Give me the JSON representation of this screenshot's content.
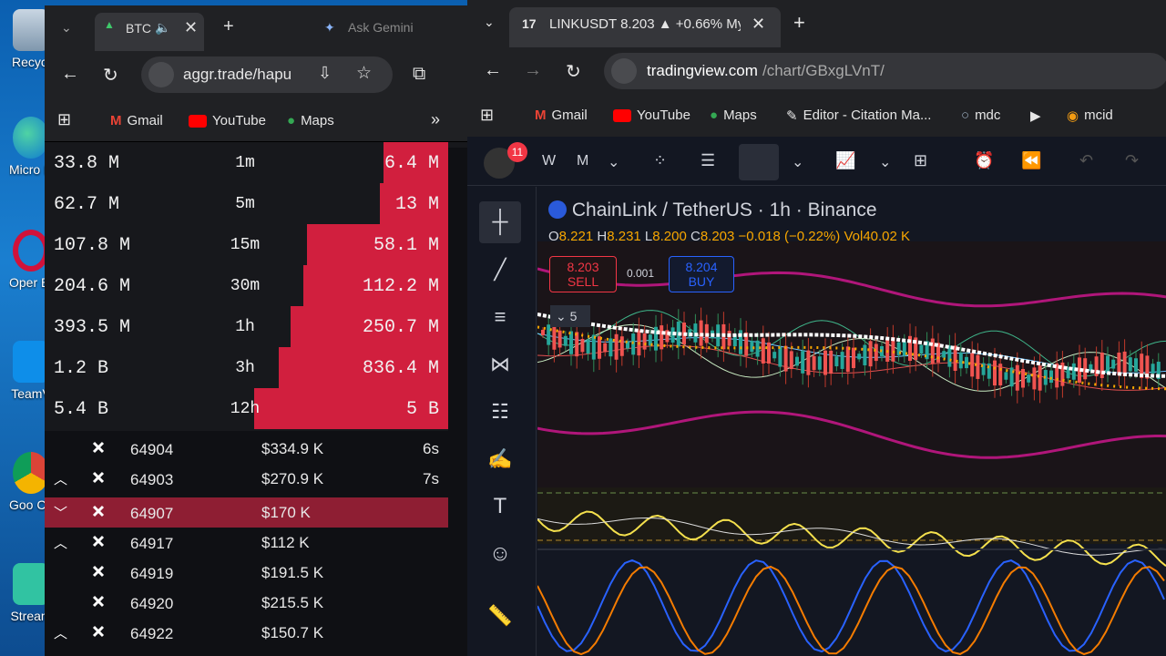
{
  "desktop": {
    "icons": [
      {
        "label": "Recycl",
        "icon": "recycle-bin-icon"
      },
      {
        "label": "Micro Edg",
        "icon": "edge-icon"
      },
      {
        "label": "Oper Brov",
        "icon": "opera-icon"
      },
      {
        "label": "TeamV",
        "icon": "teamviewer-icon"
      },
      {
        "label": "Goo Chro",
        "icon": "chrome-icon"
      },
      {
        "label": "Stream",
        "icon": "streamlabs-icon"
      }
    ]
  },
  "left_browser": {
    "tab_title": "BTC",
    "ask_gemini": "Ask Gemini",
    "url": "aggr.trade/hapu",
    "bookmarks": [
      "Gmail",
      "YouTube",
      "Maps"
    ],
    "stats": [
      {
        "left": "33.8 M",
        "tf": "1m",
        "right": "6.4 M",
        "fill": 0.16
      },
      {
        "left": "62.7 M",
        "tf": "5m",
        "right": "13 M",
        "fill": 0.17
      },
      {
        "left": "107.8 M",
        "tf": "15m",
        "right": "58.1 M",
        "fill": 0.35
      },
      {
        "left": "204.6 M",
        "tf": "30m",
        "right": "112.2 M",
        "fill": 0.36
      },
      {
        "left": "393.5 M",
        "tf": "1h",
        "right": "250.7 M",
        "fill": 0.39
      },
      {
        "left": "1.2 B",
        "tf": "3h",
        "right": "836.4 M",
        "fill": 0.42
      },
      {
        "left": "5.4 B",
        "tf": "12h",
        "right": "5 B",
        "fill": 0.48
      }
    ],
    "trades": [
      {
        "dir": "",
        "price": "64904",
        "amount": "334.9 K",
        "time": "6s",
        "highlight": false
      },
      {
        "dir": "up",
        "price": "64903",
        "amount": "270.9 K",
        "time": "7s",
        "highlight": false
      },
      {
        "dir": "down",
        "price": "64907",
        "amount": "170 K",
        "time": "",
        "highlight": true
      },
      {
        "dir": "up",
        "price": "64917",
        "amount": "112 K",
        "time": "",
        "highlight": false
      },
      {
        "dir": "",
        "price": "64919",
        "amount": "191.5 K",
        "time": "",
        "highlight": false
      },
      {
        "dir": "",
        "price": "64920",
        "amount": "215.5 K",
        "time": "",
        "highlight": false
      },
      {
        "dir": "up",
        "price": "64922",
        "amount": "150.7 K",
        "time": "",
        "highlight": false
      }
    ],
    "currency_symbol": "$"
  },
  "right_browser": {
    "tab_title": "LINKUSDT 8.203 ▲ +0.66% My",
    "url_host": "tradingview.com",
    "url_path": "/chart/GBxgLVnT/",
    "bookmarks": [
      "Gmail",
      "YouTube",
      "Maps",
      "Editor - Citation Ma...",
      "mdc",
      "mcid"
    ],
    "avatar_badge": "11",
    "toolbar_symbol_short": "W",
    "interval": "M",
    "symbol_name": "ChainLink",
    "quote_name": "TetherUS",
    "timeframe": "1h",
    "exchange": "Binance",
    "ohlc": {
      "O": "8.221",
      "H": "8.231",
      "L": "8.200",
      "C": "8.203",
      "change": "−0.018 (−0.22%)",
      "vol_label": "Vol",
      "vol": "40.02 K"
    },
    "sell_price": "8.203",
    "sell_label": "SELL",
    "buy_price": "8.204",
    "buy_label": "BUY",
    "spread": "0.001",
    "collapse_count": "5",
    "colors": {
      "sell": "#f23645",
      "buy": "#2962ff",
      "accent": "#d11f3e"
    }
  }
}
